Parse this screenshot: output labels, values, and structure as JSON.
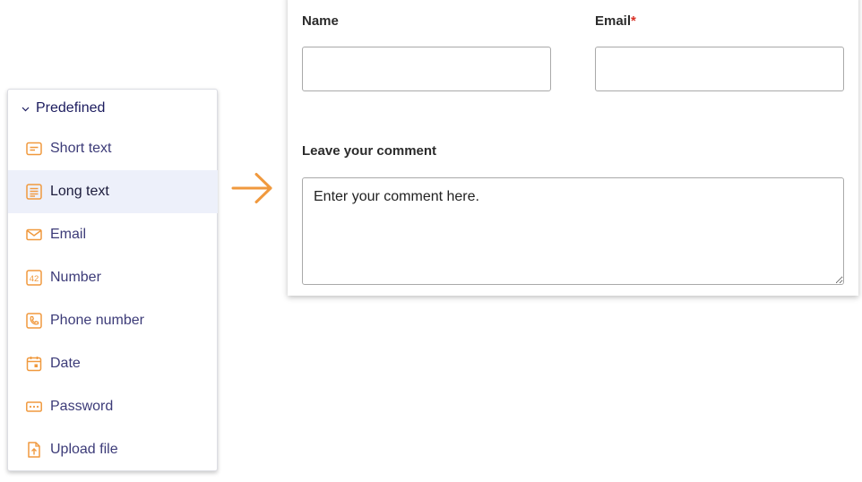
{
  "palette": {
    "header": "Predefined",
    "items": [
      {
        "label": "Short text",
        "icon": "short-text-icon",
        "active": false
      },
      {
        "label": "Long text",
        "icon": "long-text-icon",
        "active": true
      },
      {
        "label": "Email",
        "icon": "email-icon",
        "active": false
      },
      {
        "label": "Number",
        "icon": "number-icon",
        "active": false
      },
      {
        "label": "Phone number",
        "icon": "phone-icon",
        "active": false
      },
      {
        "label": "Date",
        "icon": "date-icon",
        "active": false
      },
      {
        "label": "Password",
        "icon": "password-icon",
        "active": false
      },
      {
        "label": "Upload file",
        "icon": "upload-file-icon",
        "active": false
      }
    ],
    "number_icon_text": "42"
  },
  "form": {
    "name_label": "Name",
    "name_value": "",
    "email_label": "Email",
    "email_required_mark": "*",
    "email_value": "",
    "comment_label": "Leave your comment",
    "comment_placeholder": "Enter your comment here."
  },
  "colors": {
    "accent": "#f0993e",
    "active_row": "#edf0fa",
    "label_text": "#3c3b78",
    "required": "#d93025"
  }
}
